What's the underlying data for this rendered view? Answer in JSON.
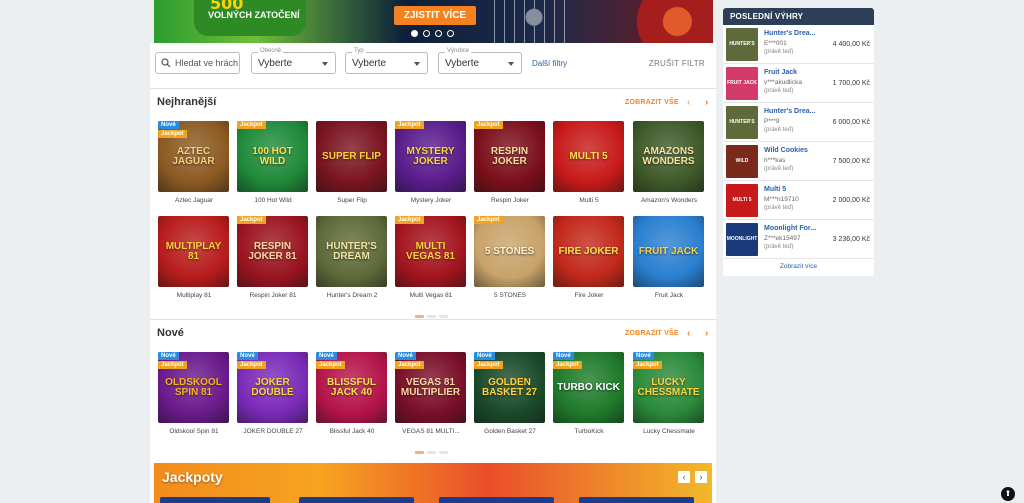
{
  "hero": {
    "big": "500",
    "sub": "VOLNÝCH ZATOČENÍ",
    "cta": "ZJISTIT VÍCE"
  },
  "filters": {
    "search_placeholder": "Hledat ve hrách",
    "select1": {
      "label": "Obecně",
      "value": "Vyberte"
    },
    "select2": {
      "label": "Typ",
      "value": "Vyberte"
    },
    "select3": {
      "label": "Výrobce",
      "value": "Vyberte"
    },
    "more": "Další filtry",
    "reset": "ZRUŠIT FILTR"
  },
  "sections": {
    "popular": {
      "title": "Nejhranější",
      "show_all": "ZOBRAZIT VŠE"
    },
    "new": {
      "title": "Nové",
      "show_all": "ZOBRAZIT VŠE"
    }
  },
  "badges": {
    "nove": "Nové",
    "jackpot": "Jackpot"
  },
  "popular_games": [
    {
      "name": "Aztec Jaguar",
      "art": "AZTEC JAGUAR",
      "bg": "#8c5a22",
      "fg": "#f5d27a",
      "nove": true,
      "jackpot": true
    },
    {
      "name": "100 Hot Wild",
      "art": "100 HOT WILD",
      "bg": "#1f8a3a",
      "fg": "#ffe14a",
      "nove": false,
      "jackpot": true
    },
    {
      "name": "Super Flip",
      "art": "SUPER FLIP",
      "bg": "#7a1420",
      "fg": "#ffd23a",
      "nove": false,
      "jackpot": false
    },
    {
      "name": "Mystery Joker",
      "art": "MYSTERY JOKER",
      "bg": "#5a1c8c",
      "fg": "#ffd23a",
      "nove": false,
      "jackpot": true
    },
    {
      "name": "Respin Joker",
      "art": "RESPIN JOKER",
      "bg": "#7a0f1a",
      "fg": "#ffd9a0",
      "nove": false,
      "jackpot": true
    },
    {
      "name": "Multi 5",
      "art": "MULTI 5",
      "bg": "#c81a1a",
      "fg": "#ffe14a",
      "nove": false,
      "jackpot": false
    },
    {
      "name": "Amazon's Wonders",
      "art": "AMAZONS WONDERS",
      "bg": "#3f5a2a",
      "fg": "#f5e3a0",
      "nove": false,
      "jackpot": false
    },
    {
      "name": "Multiplay 81",
      "art": "MULTIPLAY 81",
      "bg": "#b81c1c",
      "fg": "#ffd23a",
      "nove": false,
      "jackpot": false
    },
    {
      "name": "Respin Joker 81",
      "art": "RESPIN JOKER 81",
      "bg": "#9a1420",
      "fg": "#ffd9a0",
      "nove": false,
      "jackpot": true
    },
    {
      "name": "Hunter's Dream 2",
      "art": "HUNTER'S DREAM",
      "bg": "#5e6a3a",
      "fg": "#f5e3a0",
      "nove": false,
      "jackpot": false
    },
    {
      "name": "Multi Vegas 81",
      "art": "MULTI VEGAS 81",
      "bg": "#a3141e",
      "fg": "#ffd23a",
      "nove": false,
      "jackpot": true
    },
    {
      "name": "5 STONES",
      "art": "5 STONES",
      "bg": "#c8a36a",
      "fg": "#fff3d0",
      "nove": false,
      "jackpot": true
    },
    {
      "name": "Fire Joker",
      "art": "FIRE JOKER",
      "bg": "#c2281a",
      "fg": "#ffe14a",
      "nove": false,
      "jackpot": false
    },
    {
      "name": "Fruit Jack",
      "art": "FRUIT JACK",
      "bg": "#2a7fd0",
      "fg": "#ffd23a",
      "nove": false,
      "jackpot": false
    }
  ],
  "new_games": [
    {
      "name": "Oldskool Spin 81",
      "art": "OLDSKOOL SPIN 81",
      "bg": "#6a1a8c",
      "fg": "#ffb020",
      "nove": true,
      "jackpot": true
    },
    {
      "name": "JOKER DOUBLE 27",
      "art": "JOKER DOUBLE",
      "bg": "#7a2ab8",
      "fg": "#ffd23a",
      "nove": true,
      "jackpot": true
    },
    {
      "name": "Blissful Jack 40",
      "art": "BLISSFUL JACK 40",
      "bg": "#b4144a",
      "fg": "#ffe14a",
      "nove": true,
      "jackpot": true
    },
    {
      "name": "VEGAS 81 MULTI...",
      "art": "VEGAS 81 MULTIPLIER",
      "bg": "#7a0f2a",
      "fg": "#ffd9a0",
      "nove": true,
      "jackpot": true
    },
    {
      "name": "Golden Basket 27",
      "art": "GOLDEN BASKET 27",
      "bg": "#1a4a2a",
      "fg": "#ffd23a",
      "nove": true,
      "jackpot": true
    },
    {
      "name": "TurboKick",
      "art": "TURBO KICK",
      "bg": "#1f7a2a",
      "fg": "#ffffff",
      "nove": true,
      "jackpot": true
    },
    {
      "name": "Lucky Chessmate",
      "art": "LUCKY CHESSMATE",
      "bg": "#2a8a3a",
      "fg": "#ffd23a",
      "nove": true,
      "jackpot": true
    }
  ],
  "jackpot_strip": {
    "title": "Jackpoty"
  },
  "latest_wins": {
    "title": "POSLEDNÍ VÝHRY",
    "rows": [
      {
        "game": "Hunter's Drea...",
        "user": "E***001",
        "time": "(právě teď)",
        "amount": "4 400,00 Kč",
        "bg": "#5e6a3a",
        "art": "HUNTER'S"
      },
      {
        "game": "Fruit Jack",
        "user": "v***akudlicka",
        "time": "(právě teď)",
        "amount": "1 700,00 Kč",
        "bg": "#d23a6a",
        "art": "FRUIT JACK"
      },
      {
        "game": "Hunter's Drea...",
        "user": "P***9",
        "time": "(právě teď)",
        "amount": "6 000,00 Kč",
        "bg": "#5e6a3a",
        "art": "HUNTER'S"
      },
      {
        "game": "Wild Cookies",
        "user": "h***kas",
        "time": "(právě teď)",
        "amount": "7 500,00 Kč",
        "bg": "#7a2a1a",
        "art": "WILD"
      },
      {
        "game": "Multi 5",
        "user": "M***n19710",
        "time": "(právě teď)",
        "amount": "2 000,00 Kč",
        "bg": "#c81a1a",
        "art": "MULTI 5"
      },
      {
        "game": "Moonlight For...",
        "user": "Z***ek15497",
        "time": "(právě teď)",
        "amount": "3 236,00 Kč",
        "bg": "#1a3a7a",
        "art": "MOONLIGHT"
      }
    ],
    "more": "Zobrazit více"
  }
}
